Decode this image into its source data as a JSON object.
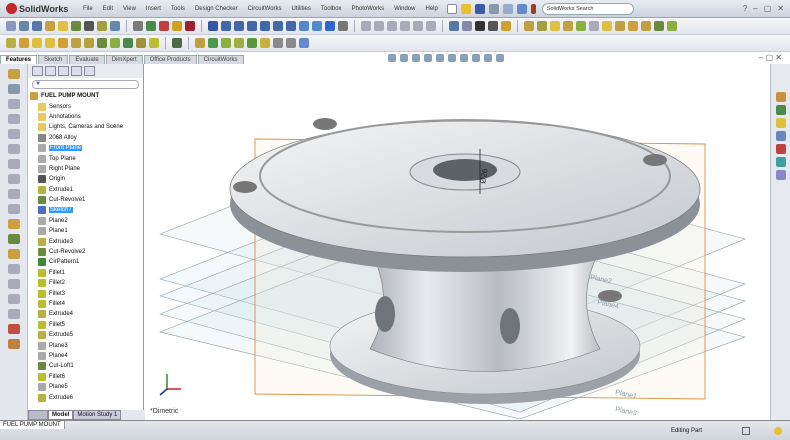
{
  "app": {
    "name": "SolidWorks"
  },
  "menu": [
    "File",
    "Edit",
    "View",
    "Insert",
    "Tools",
    "Design Checker",
    "CircuitWorks",
    "Utilities",
    "Toolbox",
    "PhotoWorks",
    "Window",
    "Help"
  ],
  "search": {
    "placeholder": "SolidWorks Search"
  },
  "window_controls": [
    "?",
    "–",
    "▢",
    "✕"
  ],
  "command_tabs": [
    "Features",
    "Sketch",
    "Evaluate",
    "DimXpert",
    "Office Products",
    "CircuitWorks"
  ],
  "active_tab": "Features",
  "tree": {
    "filter_icon": "funnel-icon",
    "root": "FUEL PUMP MOUNT",
    "items": [
      {
        "label": "Sensors",
        "color": "#e8c860"
      },
      {
        "label": "Annotations",
        "color": "#e8c860"
      },
      {
        "label": "Lights, Cameras and Scene",
        "color": "#e8c860"
      },
      {
        "label": "2068 Alloy",
        "color": "#888888"
      },
      {
        "label": "Front Plane",
        "color": "#aaaaaa",
        "selected": true
      },
      {
        "label": "Top Plane",
        "color": "#aaaaaa"
      },
      {
        "label": "Right Plane",
        "color": "#aaaaaa"
      },
      {
        "label": "Origin",
        "color": "#555555"
      },
      {
        "label": "Extrude1",
        "color": "#b8b040"
      },
      {
        "label": "Cut-Revolve1",
        "color": "#6a8a40"
      },
      {
        "label": "Sketch7",
        "color": "#4a70c0",
        "selected": true
      },
      {
        "label": "Plane2",
        "color": "#aaaaaa"
      },
      {
        "label": "Plane1",
        "color": "#aaaaaa"
      },
      {
        "label": "Extrude3",
        "color": "#b8b040"
      },
      {
        "label": "Cut-Revolve2",
        "color": "#6a8a40"
      },
      {
        "label": "CirPattern1",
        "color": "#3a8a3a"
      },
      {
        "label": "Fillet1",
        "color": "#b8c030"
      },
      {
        "label": "Fillet2",
        "color": "#b8c030"
      },
      {
        "label": "Fillet3",
        "color": "#b8c030"
      },
      {
        "label": "Fillet4",
        "color": "#b8c030"
      },
      {
        "label": "Extrude4",
        "color": "#b8b040"
      },
      {
        "label": "Fillet5",
        "color": "#b8c030"
      },
      {
        "label": "Extrude5",
        "color": "#b8b040"
      },
      {
        "label": "Plane3",
        "color": "#aaaaaa"
      },
      {
        "label": "Plane4",
        "color": "#aaaaaa"
      },
      {
        "label": "Cut-Loft1",
        "color": "#6a8a40"
      },
      {
        "label": "Fillet6",
        "color": "#b8c030"
      },
      {
        "label": "Plane5",
        "color": "#aaaaaa"
      },
      {
        "label": "Extrude6",
        "color": "#b8b040"
      }
    ]
  },
  "bottom_tabs": [
    "Model",
    "Motion Study 1"
  ],
  "viewport": {
    "view_name": "*Dimetric",
    "dimension": "Ø26",
    "plane_labels": [
      "Plane2",
      "Plane4",
      "Plane1",
      "Plane3"
    ]
  },
  "status": {
    "document": "FUEL PUMP MOUNT",
    "mode": "Editing Part"
  },
  "colors": {
    "selection": "#3399ff",
    "sketch_plane": "#e09040",
    "part": "#c8ccd2"
  }
}
